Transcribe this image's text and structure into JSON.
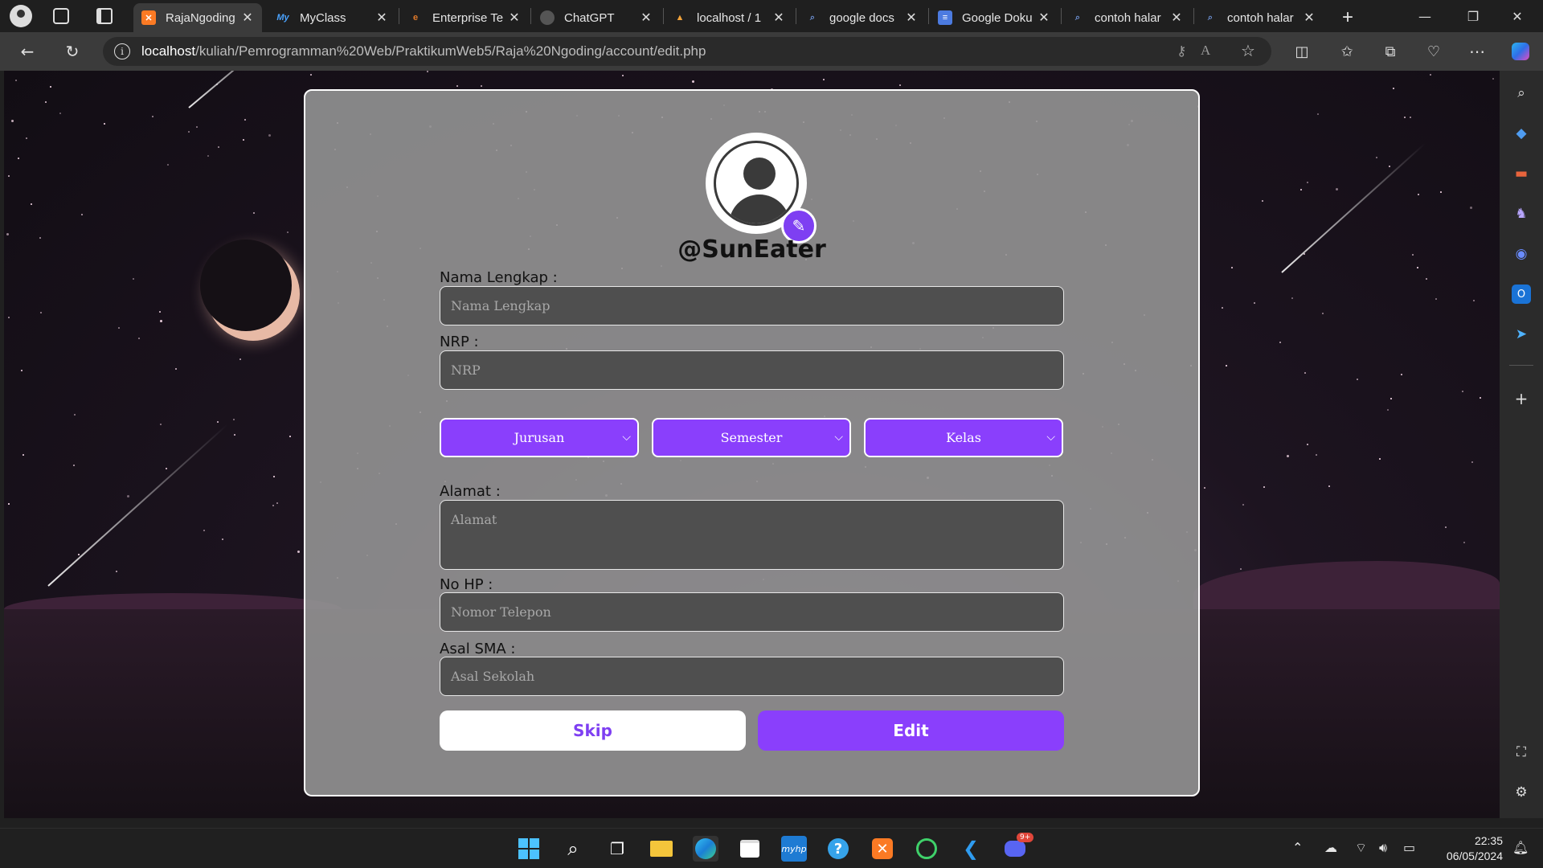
{
  "browser": {
    "tabs": [
      {
        "label": "RajaNgoding",
        "favicon": "xampp-icon",
        "active": true
      },
      {
        "label": "MyClass",
        "favicon": "myclass-icon",
        "active": false
      },
      {
        "label": "Enterprise Te",
        "favicon": "e-icon",
        "active": false
      },
      {
        "label": "ChatGPT",
        "favicon": "chatgpt-icon",
        "active": false
      },
      {
        "label": "localhost / 1",
        "favicon": "phpmyadmin-icon",
        "active": false
      },
      {
        "label": "google docs",
        "favicon": "search-icon",
        "active": false
      },
      {
        "label": "Google Doku",
        "favicon": "docs-icon",
        "active": false
      },
      {
        "label": "contoh halar",
        "favicon": "search-icon",
        "active": false
      },
      {
        "label": "contoh halar",
        "favicon": "search-icon",
        "active": false
      }
    ],
    "close_glyph": "✕",
    "new_tab_glyph": "+",
    "window_controls": {
      "minimize": "—",
      "maximize": "❐",
      "close": "✕"
    },
    "url_host": "localhost",
    "url_path": "/kuliah/Pemrogramman%20Web/PraktikumWeb5/Raja%20Ngoding/account/edit.php"
  },
  "form": {
    "username": "@SunEater",
    "nama_label": "Nama Lengkap :",
    "nama_placeholder": "Nama Lengkap",
    "nrp_label": "NRP :",
    "nrp_placeholder": "NRP",
    "jurusan": "Jurusan",
    "semester": "Semester",
    "kelas": "Kelas",
    "alamat_label": "Alamat :",
    "alamat_placeholder": "Alamat",
    "hp_label": "No HP :",
    "hp_placeholder": "Nomor Telepon",
    "sma_label": "Asal SMA :",
    "sma_placeholder": "Asal Sekolah",
    "skip_label": "Skip",
    "edit_label": "Edit"
  },
  "taskbar": {
    "clock_time": "22:35",
    "clock_date": "06/05/2024",
    "discord_badge": "9+"
  },
  "colors": {
    "accent": "#8a3ffc",
    "card": "#969696",
    "field": "#4f4f4f"
  }
}
